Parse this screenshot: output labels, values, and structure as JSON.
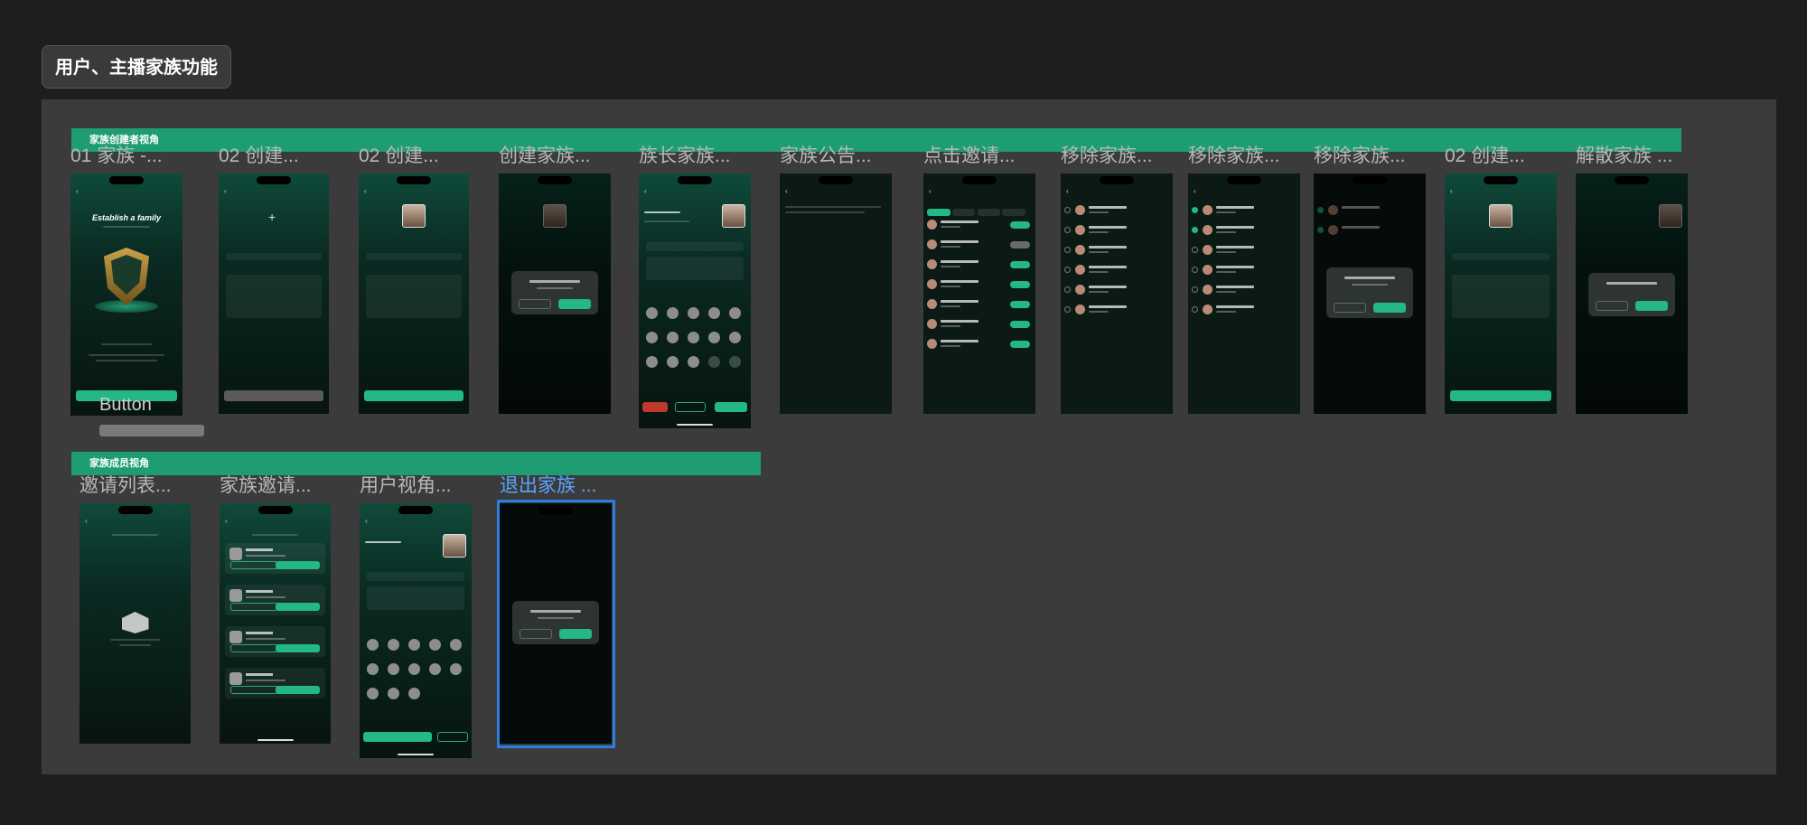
{
  "section_tag": "用户、主播家族功能",
  "bands": {
    "creator": "家族创建者视角",
    "member": "家族成员视角"
  },
  "frames_row1": [
    "01 家族 -...",
    "02 创建...",
    "02 创建...",
    "创建家族...",
    "族长家族...",
    "家族公告...",
    "点击邀请...",
    "移除家族...",
    "移除家族...",
    "移除家族...",
    "02 创建...",
    "解散家族 ..."
  ],
  "frames_row2": [
    "邀请列表...",
    "家族邀请...",
    "用户视角...",
    "退出家族 ..."
  ],
  "phone1": {
    "establish_title": "Establish a family"
  },
  "ghost_button_label": "Button",
  "colors": {
    "background": "#1e1e1e",
    "board": "#3b3b3b",
    "band": "#1f9d72",
    "accent_green": "#23b884",
    "selection": "#2a7fe0"
  }
}
